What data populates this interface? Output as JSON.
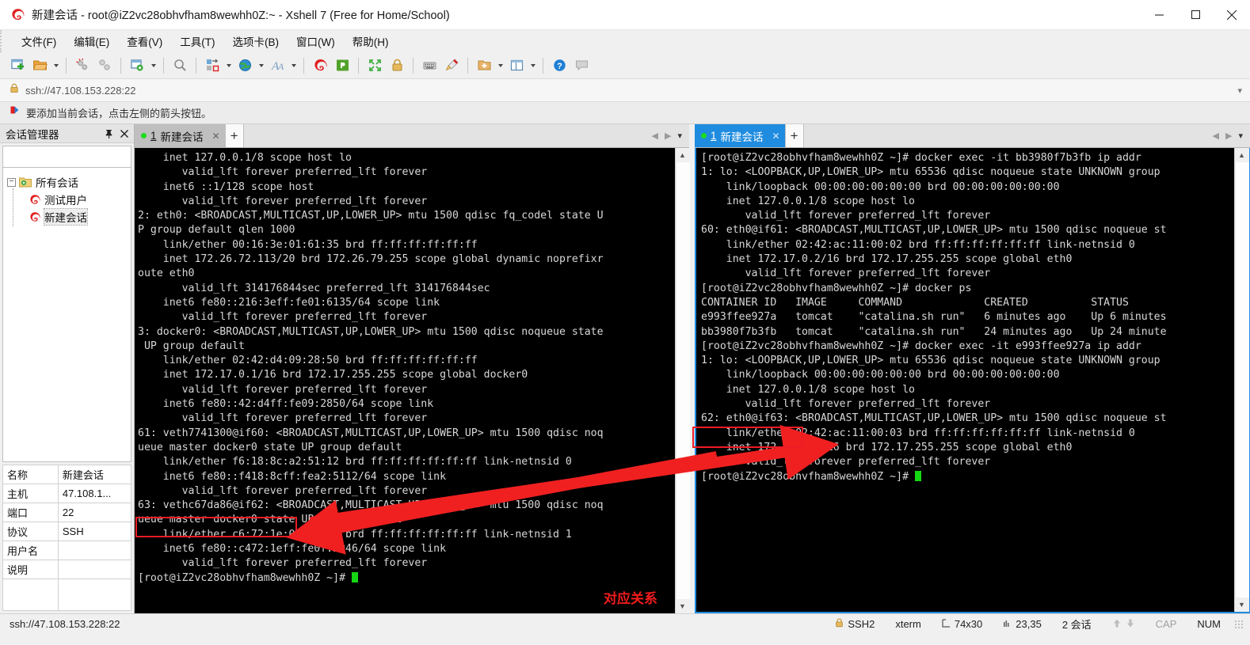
{
  "window": {
    "title": "新建会话 - root@iZ2vc28obhvfham8wewhh0Z:~ - Xshell 7 (Free for Home/School)",
    "app_icon": "xshell-logo-icon",
    "minimize": "—",
    "maximize": "▢",
    "close": "✕"
  },
  "menu": {
    "items": [
      {
        "label": "文件(F)",
        "name": "menu-file"
      },
      {
        "label": "编辑(E)",
        "name": "menu-edit"
      },
      {
        "label": "查看(V)",
        "name": "menu-view"
      },
      {
        "label": "工具(T)",
        "name": "menu-tools"
      },
      {
        "label": "选项卡(B)",
        "name": "menu-tabs"
      },
      {
        "label": "窗口(W)",
        "name": "menu-window"
      },
      {
        "label": "帮助(H)",
        "name": "menu-help"
      }
    ]
  },
  "toolbar": {
    "buttons": [
      {
        "name": "new-session-icon",
        "title": "新建"
      },
      {
        "name": "open-folder-icon",
        "title": "打开"
      },
      {
        "name": "disconnect-icon",
        "title": "断开"
      },
      {
        "name": "reconnect-icon",
        "title": "重新连接"
      },
      {
        "name": "session-properties-icon",
        "title": "属性"
      },
      {
        "name": "find-icon",
        "title": "查找"
      },
      {
        "name": "file-transfer-icon",
        "title": "传输"
      },
      {
        "name": "globe-icon",
        "title": "网络"
      },
      {
        "name": "font-icon",
        "title": "字体"
      },
      {
        "name": "xshell-icon",
        "title": "Xshell"
      },
      {
        "name": "xftp-icon",
        "title": "Xftp"
      },
      {
        "name": "fullscreen-icon",
        "title": "全屏"
      },
      {
        "name": "lock-icon",
        "title": "锁定"
      },
      {
        "name": "keyboard-icon",
        "title": "键盘"
      },
      {
        "name": "highlight-icon",
        "title": "高亮"
      },
      {
        "name": "add-folder-icon",
        "title": "新建文件夹"
      },
      {
        "name": "layout-icon",
        "title": "布局"
      },
      {
        "name": "help-icon",
        "title": "帮助"
      },
      {
        "name": "comment-icon",
        "title": "备注"
      }
    ]
  },
  "urlbar": {
    "lock_icon": "lock-icon",
    "url": "ssh://47.108.153.228:22",
    "dropdown_icon": "chevron-down-icon"
  },
  "notice": {
    "icon": "flag-icon",
    "text": "要添加当前会话，点击左侧的箭头按钮。"
  },
  "sidebar": {
    "title": "会话管理器",
    "pin_icon": "pin-icon",
    "close_icon": "close-icon",
    "search": {
      "value": "",
      "placeholder": "",
      "icon": "search-icon"
    },
    "tree": {
      "root": {
        "label": "所有会话",
        "expander": "−",
        "icon": "folder-gear-icon"
      },
      "children": [
        {
          "label": "测试用户",
          "icon": "xshell-session-icon",
          "selected": false
        },
        {
          "label": "新建会话",
          "icon": "xshell-session-icon",
          "selected": true
        }
      ]
    },
    "properties": [
      {
        "key": "名称",
        "value": "新建会话"
      },
      {
        "key": "主机",
        "value": "47.108.1..."
      },
      {
        "key": "端口",
        "value": "22"
      },
      {
        "key": "协议",
        "value": "SSH"
      },
      {
        "key": "用户名",
        "value": ""
      },
      {
        "key": "说明",
        "value": ""
      }
    ]
  },
  "panes": {
    "left": {
      "tab": {
        "num": "1",
        "label": "新建会话",
        "close_icon": "close-icon",
        "active": false,
        "status_dot_color": "#1ddb1d"
      },
      "add_tab_icon": "plus-icon",
      "nav_prev_icon": "chevron-left-icon",
      "nav_next_icon": "chevron-right-icon",
      "nav_menu_icon": "chevron-down-icon",
      "terminal_lines": [
        "    inet 127.0.0.1/8 scope host lo",
        "       valid_lft forever preferred_lft forever",
        "    inet6 ::1/128 scope host",
        "       valid_lft forever preferred_lft forever",
        "2: eth0: <BROADCAST,MULTICAST,UP,LOWER_UP> mtu 1500 qdisc fq_codel state U",
        "P group default qlen 1000",
        "    link/ether 00:16:3e:01:61:35 brd ff:ff:ff:ff:ff:ff",
        "    inet 172.26.72.113/20 brd 172.26.79.255 scope global dynamic noprefixr",
        "oute eth0",
        "       valid_lft 314176844sec preferred_lft 314176844sec",
        "    inet6 fe80::216:3eff:fe01:6135/64 scope link",
        "       valid_lft forever preferred_lft forever",
        "3: docker0: <BROADCAST,MULTICAST,UP,LOWER_UP> mtu 1500 qdisc noqueue state",
        " UP group default",
        "    link/ether 02:42:d4:09:28:50 brd ff:ff:ff:ff:ff:ff",
        "    inet 172.17.0.1/16 brd 172.17.255.255 scope global docker0",
        "       valid_lft forever preferred_lft forever",
        "    inet6 fe80::42:d4ff:fe09:2850/64 scope link",
        "       valid_lft forever preferred_lft forever",
        "61: veth7741300@if60: <BROADCAST,MULTICAST,UP,LOWER_UP> mtu 1500 qdisc noq",
        "ueue master docker0 state UP group default",
        "    link/ether f6:18:8c:a2:51:12 brd ff:ff:ff:ff:ff:ff link-netnsid 0",
        "    inet6 fe80::f418:8cff:fea2:5112/64 scope link",
        "       valid_lft forever preferred_lft forever",
        "63: vethc67da86@if62: <BROADCAST,MULTICAST,UP,LOWER_UP> mtu 1500 qdisc noq",
        "ueue master docker0 state UP group default",
        "    link/ether c6:72:1e:0f:29:46 brd ff:ff:ff:ff:ff:ff link-netnsid 1",
        "    inet6 fe80::c472:1eff:fe0f:2946/64 scope link",
        "       valid_lft forever preferred_lft forever",
        "[root@iZ2vc28obhvfham8wewhh0Z ~]# "
      ],
      "scroll_up_icon": "chevron-up-icon",
      "scroll_down_icon": "chevron-down-icon"
    },
    "right": {
      "tab": {
        "num": "1",
        "label": "新建会话",
        "close_icon": "close-icon",
        "active": true,
        "status_dot_color": "#1ddb1d"
      },
      "add_tab_icon": "plus-icon",
      "nav_prev_icon": "chevron-left-icon",
      "nav_next_icon": "chevron-right-icon",
      "nav_menu_icon": "chevron-down-icon",
      "terminal_lines": [
        "[root@iZ2vc28obhvfham8wewhh0Z ~]# docker exec -it bb3980f7b3fb ip addr",
        "1: lo: <LOOPBACK,UP,LOWER_UP> mtu 65536 qdisc noqueue state UNKNOWN group",
        "    link/loopback 00:00:00:00:00:00 brd 00:00:00:00:00:00",
        "    inet 127.0.0.1/8 scope host lo",
        "       valid_lft forever preferred_lft forever",
        "60: eth0@if61: <BROADCAST,MULTICAST,UP,LOWER_UP> mtu 1500 qdisc noqueue st",
        "    link/ether 02:42:ac:11:00:02 brd ff:ff:ff:ff:ff:ff link-netnsid 0",
        "    inet 172.17.0.2/16 brd 172.17.255.255 scope global eth0",
        "       valid_lft forever preferred_lft forever",
        "[root@iZ2vc28obhvfham8wewhh0Z ~]# docker ps",
        "CONTAINER ID   IMAGE     COMMAND             CREATED          STATUS",
        "e993ffee927a   tomcat    \"catalina.sh run\"   6 minutes ago    Up 6 minutes",
        "bb3980f7b3fb   tomcat    \"catalina.sh run\"   24 minutes ago   Up 24 minute",
        "[root@iZ2vc28obhvfham8wewhh0Z ~]# docker exec -it e993ffee927a ip addr",
        "1: lo: <LOOPBACK,UP,LOWER_UP> mtu 65536 qdisc noqueue state UNKNOWN group",
        "    link/loopback 00:00:00:00:00:00 brd 00:00:00:00:00:00",
        "    inet 127.0.0.1/8 scope host lo",
        "       valid_lft forever preferred_lft forever",
        "62: eth0@if63: <BROADCAST,MULTICAST,UP,LOWER_UP> mtu 1500 qdisc noqueue st",
        "    link/ether 02:42:ac:11:00:03 brd ff:ff:ff:ff:ff:ff link-netnsid 0",
        "    inet 172.17.0.3/16 brd 172.17.255.255 scope global eth0",
        "       valid_lft forever preferred_lft forever",
        "[root@iZ2vc28obhvfham8wewhh0Z ~]# "
      ],
      "scroll_up_icon": "chevron-up-icon",
      "scroll_down_icon": "chevron-down-icon"
    }
  },
  "annotations": {
    "color": "#ee1c25",
    "label": "对应关系",
    "highlight_left": "63: vethc67da86@if62:",
    "highlight_right": "62: eth0@if63:"
  },
  "statusbar": {
    "left_url": "ssh://47.108.153.228:22",
    "items": [
      {
        "name": "status-protocol",
        "icon": "lock-icon",
        "label": "SSH2",
        "dim": false
      },
      {
        "name": "status-term-type",
        "icon": "",
        "label": "xterm",
        "dim": false
      },
      {
        "name": "status-size",
        "icon": "size-icon",
        "label": "74x30",
        "dim": false
      },
      {
        "name": "status-cursor-pos",
        "icon": "pos-icon",
        "label": "23,35",
        "dim": false
      },
      {
        "name": "status-session-count",
        "icon": "",
        "label": "2 会话",
        "dim": false
      },
      {
        "name": "status-transfer",
        "icon": "arrows-icon",
        "label": "",
        "dim": true
      },
      {
        "name": "status-caps",
        "icon": "",
        "label": "CAP",
        "dim": true
      },
      {
        "name": "status-num",
        "icon": "",
        "label": "NUM",
        "dim": false
      }
    ]
  }
}
